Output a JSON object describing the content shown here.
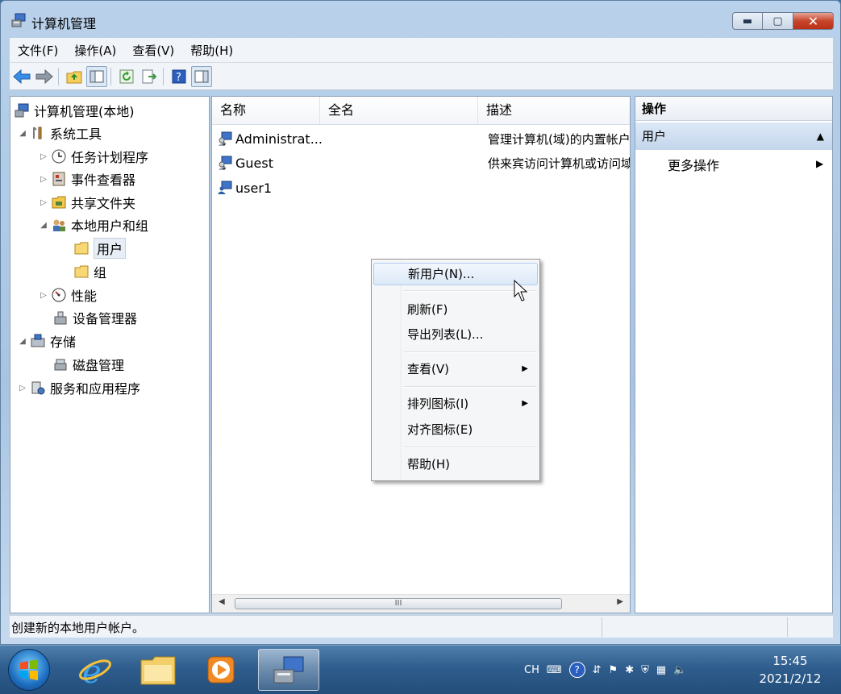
{
  "window": {
    "title": "计算机管理",
    "controls": {
      "minimize": "▬",
      "maximize": "▢",
      "close": "✕"
    }
  },
  "menubar": [
    "文件(F)",
    "操作(A)",
    "查看(V)",
    "帮助(H)"
  ],
  "tree": {
    "root": "计算机管理(本地)",
    "system_tools": "系统工具",
    "task_scheduler": "任务计划程序",
    "event_viewer": "事件查看器",
    "shared_folders": "共享文件夹",
    "local_users_groups": "本地用户和组",
    "users": "用户",
    "groups": "组",
    "performance": "性能",
    "device_manager": "设备管理器",
    "storage": "存储",
    "disk_management": "磁盘管理",
    "services_apps": "服务和应用程序"
  },
  "list": {
    "columns": [
      "名称",
      "全名",
      "描述"
    ],
    "rows": [
      {
        "name": "Administrat...",
        "fullname": "",
        "description": "管理计算机(域)的内置帐户"
      },
      {
        "name": "Guest",
        "fullname": "",
        "description": "供来宾访问计算机或访问域"
      },
      {
        "name": "user1",
        "fullname": "",
        "description": ""
      }
    ],
    "scroll_grip": "III"
  },
  "actions": {
    "header": "操作",
    "section": "用户",
    "more": "更多操作"
  },
  "context_menu": {
    "new_user": "新用户(N)...",
    "refresh": "刷新(F)",
    "export_list": "导出列表(L)...",
    "view": "查看(V)",
    "arrange_icons": "排列图标(I)",
    "align_icons": "对齐图标(E)",
    "help": "帮助(H)"
  },
  "statusbar": {
    "text": "创建新的本地用户帐户。"
  },
  "taskbar": {
    "tray_lang": "CH",
    "time": "15:45",
    "date": "2021/2/12"
  },
  "colors": {
    "selection": "#dde9f8",
    "taskbar": "#2f5d8d",
    "accent": "#1e6fc0"
  }
}
